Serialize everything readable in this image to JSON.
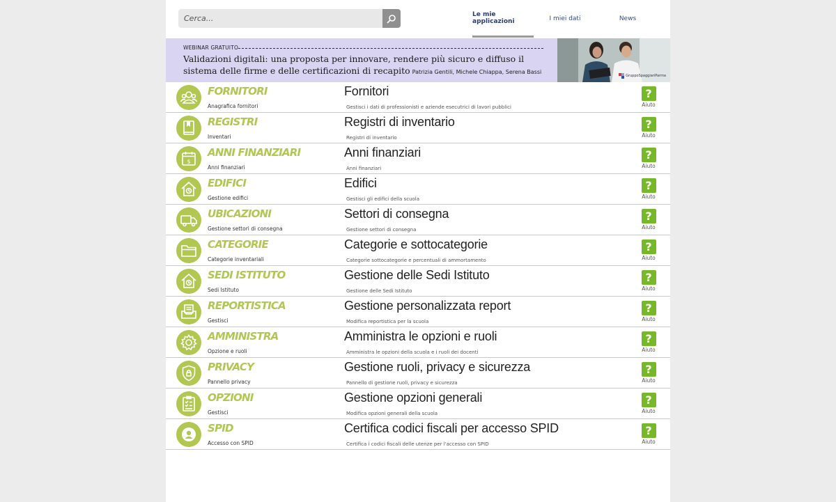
{
  "search": {
    "placeholder": "Cerca..."
  },
  "tabs": [
    {
      "label": "Le mie applicazioni",
      "active": true
    },
    {
      "label": "I miei dati",
      "active": false
    },
    {
      "label": "News",
      "active": false
    }
  ],
  "banner": {
    "tag": "WEBINAR GRATUITO",
    "title": "Validazioni digitali: una proposta per innovare, rendere più sicuro e diffuso il sistema delle firme e delle certificazioni di recapito",
    "authors": "Patrizia Gentili, Michele Chiappa, Serena Bassi",
    "logo": "GruppoSpaggiariParma"
  },
  "help_label": "Aiuto",
  "apps": [
    {
      "title": "Fornitori",
      "subtitle": "Anagrafica fornitori",
      "name": "Fornitori",
      "description": "Gestisci i dati di professionisti e aziende esecutrici di lavori pubblici",
      "icon": "users-icon"
    },
    {
      "title": "Registri",
      "subtitle": "Inventari",
      "name": "Registri di inventario",
      "description": "Registri di inventario",
      "icon": "book-icon"
    },
    {
      "title": "Anni finanziari",
      "subtitle": "Anni finanziari",
      "name": "Anni finanziari",
      "description": "Anni finanziari",
      "icon": "calendar-dollar-icon"
    },
    {
      "title": "Edifici",
      "subtitle": "Gestione edifici",
      "name": "Edifici",
      "description": "Gestisci gli edifici della scuola",
      "icon": "house-clock-icon"
    },
    {
      "title": "Ubicazioni",
      "subtitle": "Gestione settori di consegna",
      "name": "Settori di consegna",
      "description": "Gestione settori di consegna",
      "icon": "truck-icon"
    },
    {
      "title": "Categorie",
      "subtitle": "Categorie inventariali",
      "name": "Categorie e sottocategorie",
      "description": "Categorie sottocategorie e percentuali di ammortamento",
      "icon": "folder-icon"
    },
    {
      "title": "Sedi Istituto",
      "subtitle": "Sedi Istituto",
      "name": "Gestione delle Sedi Istituto",
      "description": "Gestione delle Sedi Istituto",
      "icon": "house-clock-icon"
    },
    {
      "title": "Reportistica",
      "subtitle": "Gestisci",
      "name": "Gestione personalizzata report",
      "description": "Modifica reportistica per la scuola",
      "icon": "report-icon"
    },
    {
      "title": "Amministra",
      "subtitle": "Opzione e ruoli",
      "name": "Amministra le opzioni e ruoli",
      "description": "Amministra le opzioni della scuola e i ruoli dei docenti",
      "icon": "gear-icon"
    },
    {
      "title": "Privacy",
      "subtitle": "Pannello privacy",
      "name": "Gestione ruoli, privacy e sicurezza",
      "description": "Pannello di gestione ruoli, privacy e sicurezza",
      "icon": "shield-lock-icon"
    },
    {
      "title": "Opzioni",
      "subtitle": "Gestisci",
      "name": "Gestione opzioni generali",
      "description": "Modifica opzioni generali della scuola",
      "icon": "checklist-icon"
    },
    {
      "title": "SPID",
      "subtitle": "Accesso con SPID",
      "name": "Certifica codici fiscali per accesso SPID",
      "description": "Certifica i codici fiscali delle utenze per l'accesso con SPID",
      "icon": "user-circle-icon"
    }
  ],
  "colors": {
    "accent_green": "#b1c752",
    "help_green": "#76b82a",
    "banner_bg": "#d9d4f2"
  }
}
